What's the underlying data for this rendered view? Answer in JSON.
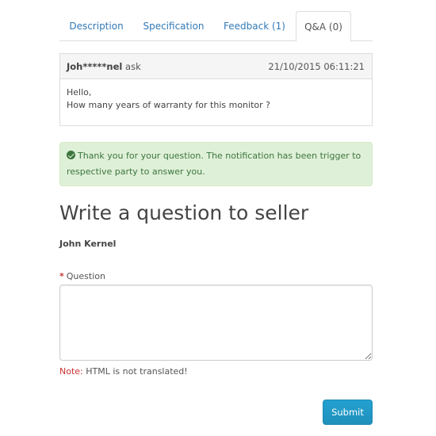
{
  "tabs": [
    {
      "label": "Description"
    },
    {
      "label": "Specification"
    },
    {
      "label": "Feedback (1)"
    },
    {
      "label": "Q&A (0)",
      "active": true
    }
  ],
  "qa_entry": {
    "author": "Joh*****nel",
    "verb": "ask",
    "date": "21/10/2015 06:11:21",
    "greeting": "Hello,",
    "message": "How many years of warranty for this monitor ?"
  },
  "alert": {
    "icon": "check-circle-icon",
    "message": "Thank you for your question. The notification has been trigger to respective party to answer you."
  },
  "form": {
    "title": "Write a question to seller",
    "author_name": "John Kernel",
    "question_required_mark": "*",
    "question_label": "Question",
    "question_value": "",
    "note_label": "Note:",
    "note_text": "HTML is not translated!",
    "submit_label": "Submit"
  },
  "colors": {
    "link": "#337ab7",
    "alert_bg": "#dff0d8",
    "alert_text": "#3c763d",
    "required": "#cc3333",
    "button": "#229ac8"
  }
}
